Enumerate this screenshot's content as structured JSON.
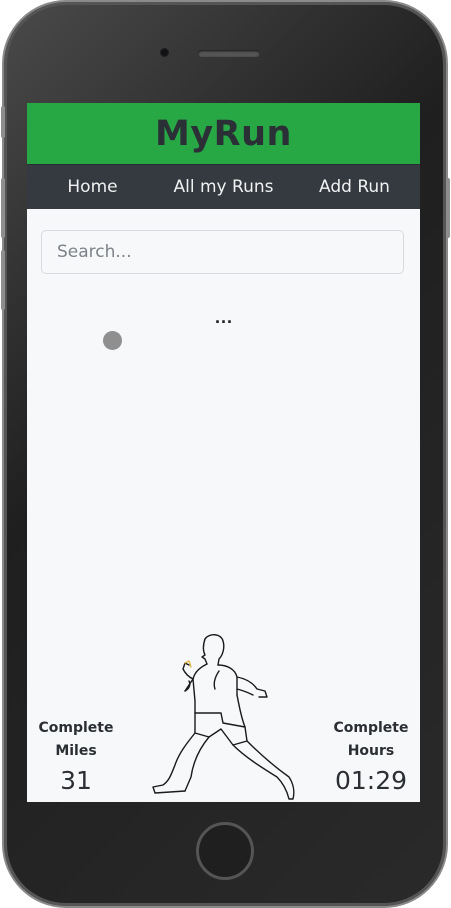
{
  "header": {
    "title": "MyRun"
  },
  "nav": {
    "items": [
      {
        "label": "Home"
      },
      {
        "label": "All my Runs"
      },
      {
        "label": "Add Run"
      }
    ]
  },
  "search": {
    "placeholder": "Search...",
    "value": ""
  },
  "loading": {
    "text": "..."
  },
  "stats": {
    "miles": {
      "label": "Complete Miles",
      "value": "31"
    },
    "hours": {
      "label": "Complete Hours",
      "value": "01:29"
    }
  },
  "colors": {
    "brand": "#28a745",
    "nav": "#343a40",
    "background": "#f7f8fa"
  }
}
